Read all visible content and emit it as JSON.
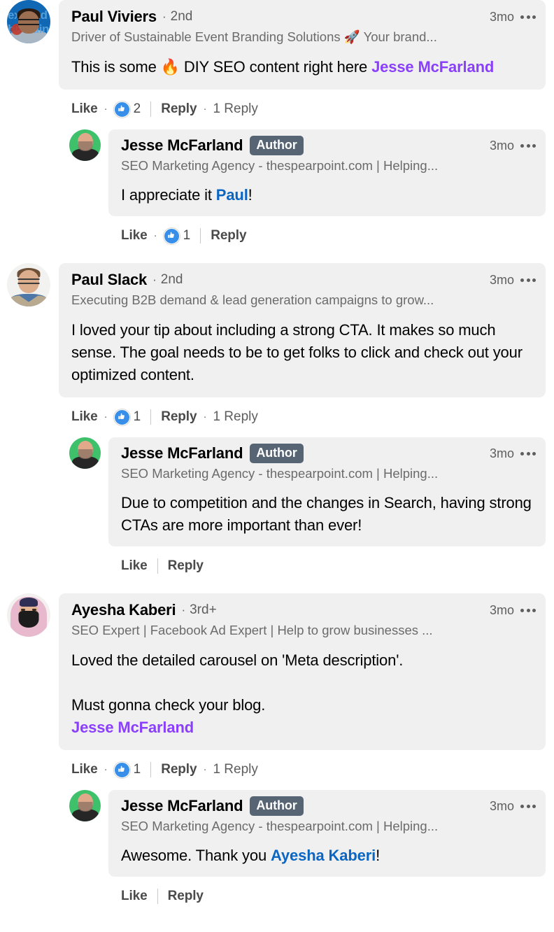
{
  "thread": {
    "comments": [
      {
        "id": "c1",
        "level": "top",
        "avatar": "av-paulviviers",
        "avatar_name": "avatar-paul-viviers",
        "avatar_brand_text": "expand branding",
        "author": "Paul Viviers",
        "separator": "·",
        "degree": "2nd",
        "is_author_badge": false,
        "badge_label": "",
        "headline": "Driver of Sustainable Event Branding Solutions 🚀 Your brand...",
        "timestamp": "3mo",
        "text_parts": [
          {
            "t": "This is some 🔥 DIY SEO content right here ",
            "style": "plain"
          },
          {
            "t": "Jesse McFarland",
            "style": "mention-purple"
          }
        ],
        "actions": {
          "like_label": "Like",
          "has_reaction": true,
          "reaction_icon": "thumbs-up-icon",
          "reaction_count": "2",
          "reply_label": "Reply",
          "has_replies_count": true,
          "replies_count_label": "1 Reply"
        }
      },
      {
        "id": "c2",
        "level": "reply",
        "avatar": "av-jesse",
        "avatar_name": "avatar-jesse-mcfarland",
        "avatar_brand_text": "",
        "author": "Jesse McFarland",
        "separator": "",
        "degree": "",
        "is_author_badge": true,
        "badge_label": "Author",
        "headline": "SEO Marketing Agency - thespearpoint.com | Helping...",
        "timestamp": "3mo",
        "text_parts": [
          {
            "t": "I appreciate it ",
            "style": "plain"
          },
          {
            "t": "Paul",
            "style": "mention-blue"
          },
          {
            "t": "!",
            "style": "plain"
          }
        ],
        "actions": {
          "like_label": "Like",
          "has_reaction": true,
          "reaction_icon": "thumbs-up-icon",
          "reaction_count": "1",
          "reply_label": "Reply",
          "has_replies_count": false,
          "replies_count_label": ""
        }
      },
      {
        "id": "c3",
        "level": "top",
        "avatar": "av-paulslack",
        "avatar_name": "avatar-paul-slack",
        "avatar_brand_text": "",
        "author": "Paul Slack",
        "separator": "·",
        "degree": "2nd",
        "is_author_badge": false,
        "badge_label": "",
        "headline": "Executing B2B demand & lead generation campaigns to grow...",
        "timestamp": "3mo",
        "text_parts": [
          {
            "t": "I loved your tip about including a strong CTA. It makes so much sense. The goal needs to be to get folks to click and check out your optimized content.",
            "style": "plain"
          }
        ],
        "actions": {
          "like_label": "Like",
          "has_reaction": true,
          "reaction_icon": "thumbs-up-icon",
          "reaction_count": "1",
          "reply_label": "Reply",
          "has_replies_count": true,
          "replies_count_label": "1 Reply"
        }
      },
      {
        "id": "c4",
        "level": "reply",
        "avatar": "av-jesse",
        "avatar_name": "avatar-jesse-mcfarland",
        "avatar_brand_text": "",
        "author": "Jesse McFarland",
        "separator": "",
        "degree": "",
        "is_author_badge": true,
        "badge_label": "Author",
        "headline": "SEO Marketing Agency - thespearpoint.com | Helping...",
        "timestamp": "3mo",
        "text_parts": [
          {
            "t": "Due to competition and the changes in Search, having strong CTAs are more important than ever!",
            "style": "plain"
          }
        ],
        "actions": {
          "like_label": "Like",
          "has_reaction": false,
          "reaction_icon": "",
          "reaction_count": "",
          "reply_label": "Reply",
          "has_replies_count": false,
          "replies_count_label": ""
        }
      },
      {
        "id": "c5",
        "level": "top",
        "avatar": "av-ayesha",
        "avatar_name": "avatar-ayesha-kaberi",
        "avatar_brand_text": "",
        "author": "Ayesha Kaberi",
        "separator": "·",
        "degree": "3rd+",
        "is_author_badge": false,
        "badge_label": "",
        "headline": "SEO Expert | Facebook Ad Expert | Help to grow businesses ...",
        "timestamp": "3mo",
        "text_parts": [
          {
            "t": "Loved the detailed carousel on 'Meta description'.\n\nMust gonna check your blog.\n",
            "style": "plain"
          },
          {
            "t": "Jesse McFarland",
            "style": "mention-purple"
          }
        ],
        "actions": {
          "like_label": "Like",
          "has_reaction": true,
          "reaction_icon": "thumbs-up-icon",
          "reaction_count": "1",
          "reply_label": "Reply",
          "has_replies_count": true,
          "replies_count_label": "1 Reply"
        }
      },
      {
        "id": "c6",
        "level": "reply",
        "avatar": "av-jesse",
        "avatar_name": "avatar-jesse-mcfarland",
        "avatar_brand_text": "",
        "author": "Jesse McFarland",
        "separator": "",
        "degree": "",
        "is_author_badge": true,
        "badge_label": "Author",
        "headline": "SEO Marketing Agency - thespearpoint.com | Helping...",
        "timestamp": "3mo",
        "text_parts": [
          {
            "t": "Awesome. Thank you ",
            "style": "plain"
          },
          {
            "t": "Ayesha Kaberi",
            "style": "mention-blue"
          },
          {
            "t": "!",
            "style": "plain"
          }
        ],
        "actions": {
          "like_label": "Like",
          "has_reaction": false,
          "reaction_icon": "",
          "reaction_count": "",
          "reply_label": "Reply",
          "has_replies_count": false,
          "replies_count_label": ""
        }
      }
    ]
  },
  "colors": {
    "bubble_bg": "#f0f0f0",
    "mention_purple": "#8a3ffc",
    "mention_blue": "#0a66c2",
    "author_badge_bg": "#566474",
    "reaction_blue": "#378fe9",
    "muted_text": "#5e5e5e"
  }
}
